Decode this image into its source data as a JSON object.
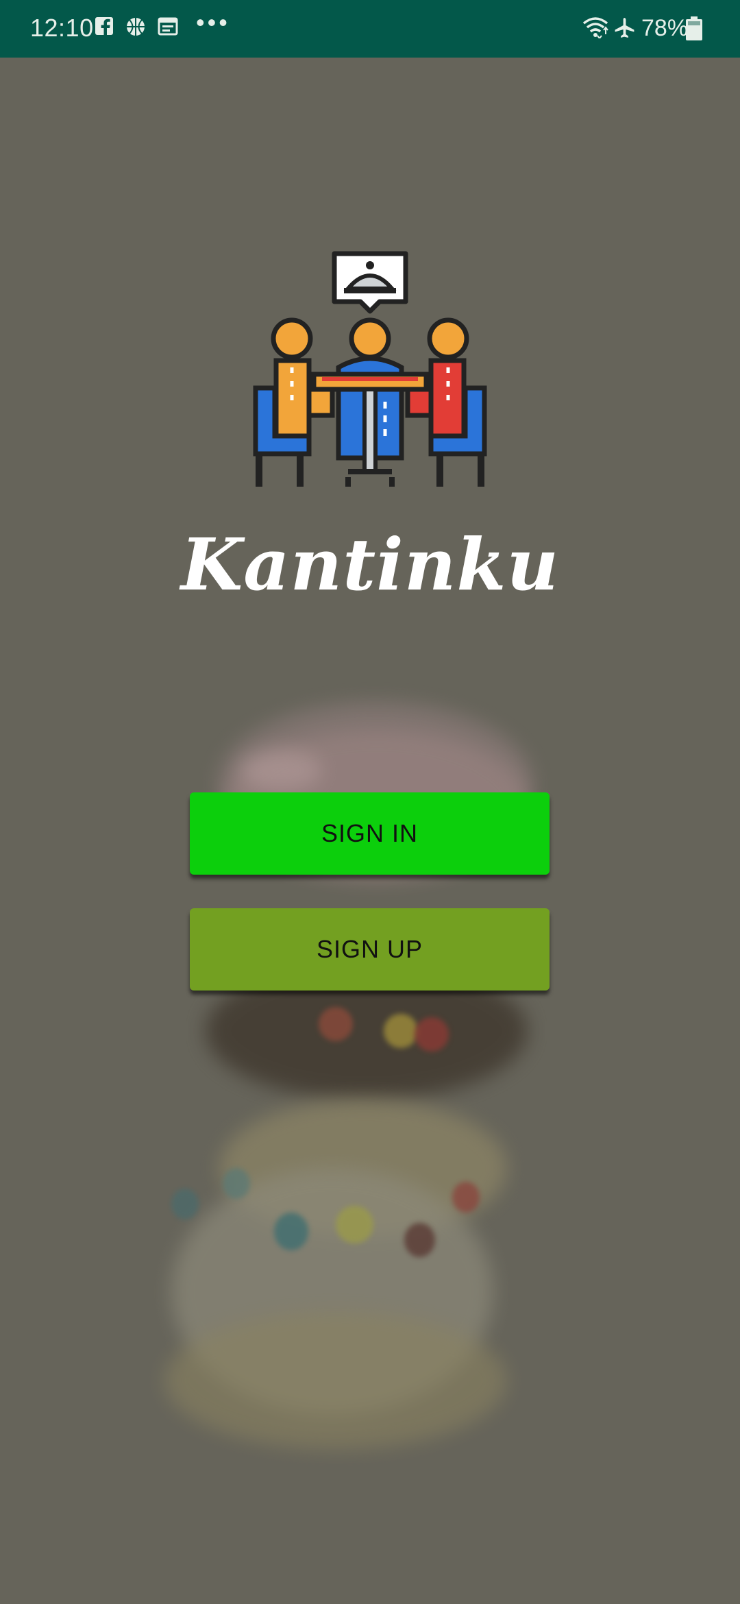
{
  "status_bar": {
    "time": "12:10",
    "battery": "78%",
    "overflow": "•••",
    "icons": [
      "facebook-icon",
      "basketball-icon",
      "calendar-icon",
      "wifi-icon",
      "airplane-icon",
      "battery-icon"
    ]
  },
  "app": {
    "title": "Kantinku"
  },
  "actions": {
    "sign_in": "SIGN IN",
    "sign_up": "SIGN UP"
  },
  "colors": {
    "status_bar": "#03584a",
    "background": "#66645a",
    "sign_in": "#0ccf0c",
    "sign_up": "#73a021"
  }
}
